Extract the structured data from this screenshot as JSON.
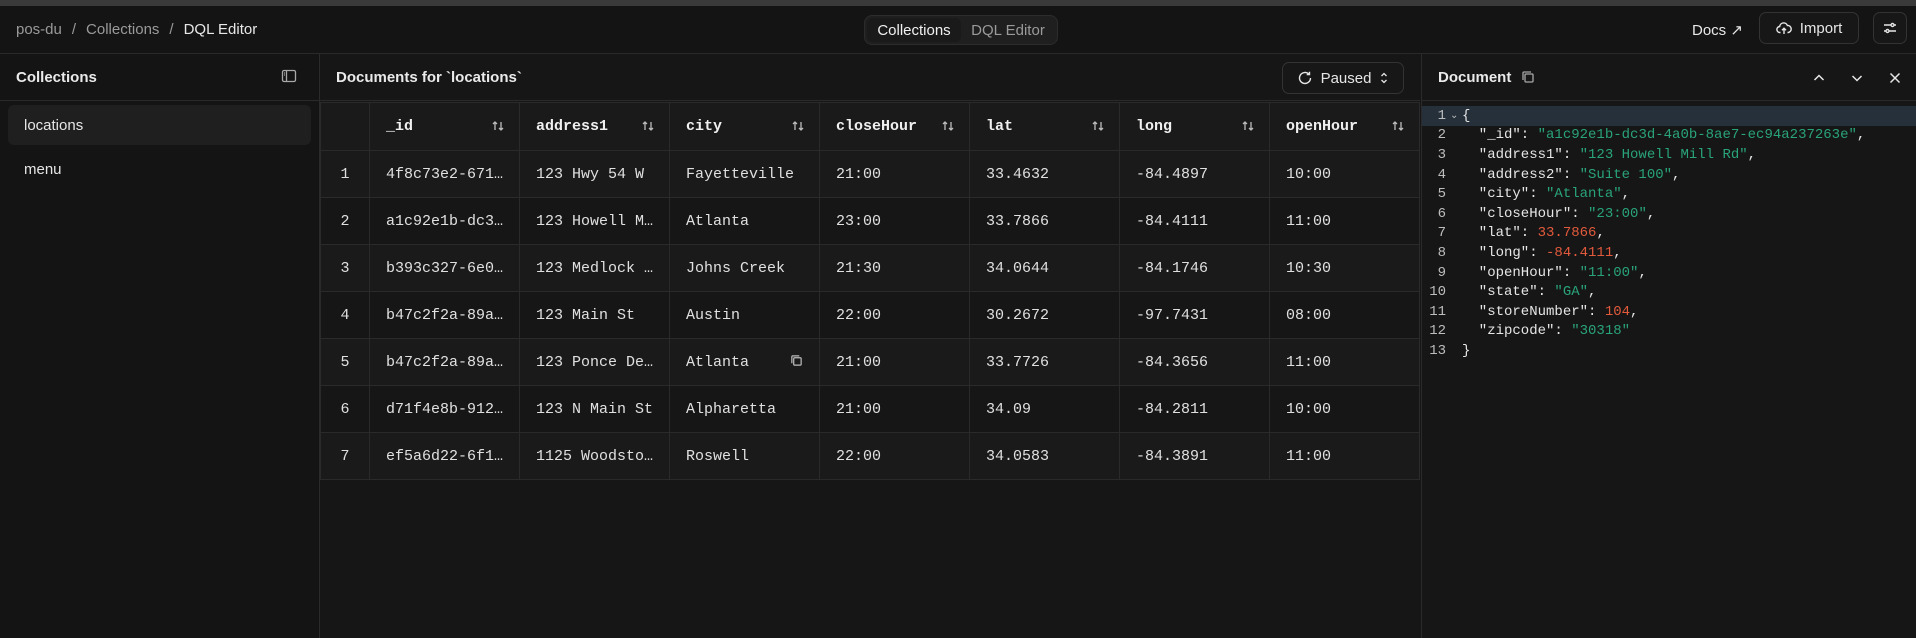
{
  "breadcrumb": [
    "pos-du",
    "Collections",
    "DQL Editor"
  ],
  "nav_tabs": [
    {
      "label": "Collections",
      "active": true
    },
    {
      "label": "DQL Editor",
      "active": false
    }
  ],
  "top_actions": {
    "docs": "Docs ↗",
    "import": "Import"
  },
  "sidebar": {
    "title": "Collections",
    "items": [
      {
        "label": "locations",
        "active": true
      },
      {
        "label": "menu",
        "active": false
      }
    ]
  },
  "main": {
    "title": "Documents for `locations`",
    "live_button": "Paused",
    "columns": [
      "_id",
      "address1",
      "city",
      "closeHour",
      "lat",
      "long",
      "openHour"
    ],
    "rows": [
      [
        "1",
        "4f8c73e2-671…",
        "123 Hwy 54 W",
        "Fayetteville",
        "21:00",
        "33.4632",
        "-84.4897",
        "10:00"
      ],
      [
        "2",
        "a1c92e1b-dc3…",
        "123 Howell M…",
        "Atlanta",
        "23:00",
        "33.7866",
        "-84.4111",
        "11:00"
      ],
      [
        "3",
        "b393c327-6e0…",
        "123 Medlock …",
        "Johns Creek",
        "21:30",
        "34.0644",
        "-84.1746",
        "10:30"
      ],
      [
        "4",
        "b47c2f2a-89a…",
        "123 Main St",
        "Austin",
        "22:00",
        "30.2672",
        "-97.7431",
        "08:00"
      ],
      [
        "5",
        "b47c2f2a-89a…",
        "123 Ponce De…",
        "Atlanta",
        "21:00",
        "33.7726",
        "-84.3656",
        "11:00"
      ],
      [
        "6",
        "d71f4e8b-912…",
        "123 N Main St",
        "Alpharetta",
        "21:00",
        "34.09",
        "-84.2811",
        "10:00"
      ],
      [
        "7",
        "ef5a6d22-6f1…",
        "1125 Woodsto…",
        "Roswell",
        "22:00",
        "34.0583",
        "-84.3891",
        "11:00"
      ]
    ]
  },
  "document": {
    "title": "Document",
    "fields": [
      {
        "key": "\"_id\"",
        "value": "\"a1c92e1b-dc3d-4a0b-8ae7-ec94a237263e\"",
        "kind": "string"
      },
      {
        "key": "\"address1\"",
        "value": "\"123 Howell Mill Rd\"",
        "kind": "string"
      },
      {
        "key": "\"address2\"",
        "value": "\"Suite 100\"",
        "kind": "string"
      },
      {
        "key": "\"city\"",
        "value": "\"Atlanta\"",
        "kind": "string"
      },
      {
        "key": "\"closeHour\"",
        "value": "\"23:00\"",
        "kind": "string"
      },
      {
        "key": "\"lat\"",
        "value": "33.7866",
        "kind": "number"
      },
      {
        "key": "\"long\"",
        "value": "-84.4111",
        "kind": "number"
      },
      {
        "key": "\"openHour\"",
        "value": "\"11:00\"",
        "kind": "string"
      },
      {
        "key": "\"state\"",
        "value": "\"GA\"",
        "kind": "string"
      },
      {
        "key": "\"storeNumber\"",
        "value": "104",
        "kind": "number"
      },
      {
        "key": "\"zipcode\"",
        "value": "\"30318\"",
        "kind": "string"
      }
    ]
  }
}
